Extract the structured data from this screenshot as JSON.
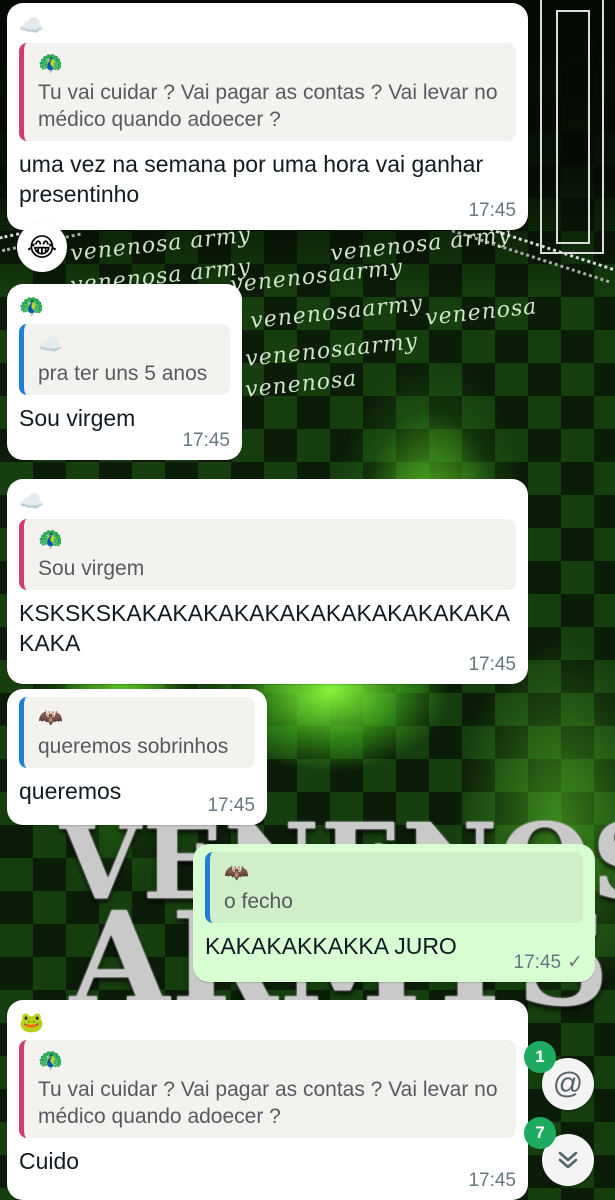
{
  "reaction": {
    "emoji": "😂"
  },
  "messages": [
    {
      "sender_emoji": "☁️",
      "quote": {
        "author_emoji": "🦚",
        "text": "Tu vai cuidar ? Vai pagar as contas ? Vai levar no médico quando adoecer ?",
        "bar_color": "#d23b70"
      },
      "text": "uma vez na semana por uma hora vai ganhar presentinho",
      "time": "17:45"
    },
    {
      "sender_emoji": "🦚",
      "quote": {
        "author_emoji": "☁️",
        "text": "pra ter uns 5 anos",
        "bar_color": "#1f7ed6"
      },
      "text": "Sou virgem",
      "time": "17:45"
    },
    {
      "sender_emoji": "☁️",
      "quote": {
        "author_emoji": "🦚",
        "text": "Sou virgem",
        "bar_color": "#d23b70"
      },
      "text": "KSKSKSKAKAKAKAKAKAKAKAKAKAKAKAKAKAKA",
      "time": "17:45"
    },
    {
      "sender_emoji": "",
      "quote": {
        "author_emoji": "🦇",
        "text": "queremos sobrinhos",
        "bar_color": "#1f7ed6"
      },
      "text": "queremos",
      "time": "17:45"
    },
    {
      "sender_emoji": "",
      "outgoing": true,
      "quote": {
        "author_emoji": "🦇",
        "text": "o fecho",
        "bar_color": "#1f7ed6"
      },
      "text": "KAKAKAKKAKKA JURO",
      "time": "17:45",
      "status": "✓"
    },
    {
      "sender_emoji": "🐸",
      "quote": {
        "author_emoji": "🦚",
        "text": "Tu vai cuidar ? Vai pagar as contas ? Vai levar no médico quando adoecer ?",
        "bar_color": "#d23b70"
      },
      "text": "Cuido",
      "time": "17:45"
    }
  ],
  "fabs": {
    "mentions": {
      "icon": "@",
      "count": "1"
    },
    "scroll_down": {
      "icon": "⌄",
      "count": "7"
    }
  },
  "wallpaper": {
    "watermark_1": "venenosa army",
    "watermark_2": "venenosaarmy",
    "watermark_3": "venenosa",
    "title_1": "VENENOSA",
    "title_2": "ARMYS"
  },
  "colors": {
    "incoming_bubble": "#ffffff",
    "outgoing_bubble": "#d9fdd3",
    "quote_pink": "#d23b70",
    "quote_blue": "#1f7ed6",
    "badge_green": "#1daa61"
  }
}
